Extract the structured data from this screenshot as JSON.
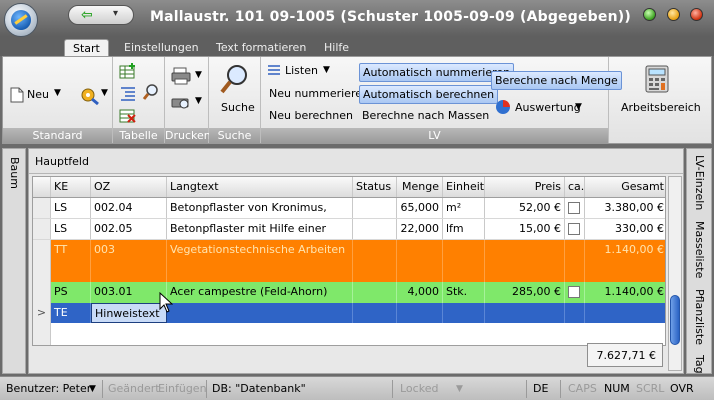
{
  "window": {
    "title": "Mallaustr. 101 09-1005 (Schuster 1005-09-09 (Abgegeben))",
    "qat_back": "⇦",
    "qat_menu": "▾"
  },
  "tabs": [
    "Start",
    "Einstellungen",
    "Text formatieren",
    "Hilfe"
  ],
  "ribbon": {
    "standard": {
      "neu": "Neu",
      "label": "Standard"
    },
    "tabelle": {
      "label": "Tabelle"
    },
    "drucken": {
      "label": "Drucken"
    },
    "suche": {
      "button": "Suche",
      "label": "Suche"
    },
    "lv": {
      "listen": "Listen",
      "neu_nummerieren": "Neu nummerieren",
      "neu_berechnen": "Neu berechnen",
      "auto_nummerieren": "Automatisch nummerieren",
      "auto_berechnen": "Automatisch berechnen",
      "berechne_massen": "Berechne nach Massen",
      "berechne_menge": "Berechne nach Menge",
      "auswertung": "Auswertung",
      "label": "LV"
    },
    "arbeitsbereich": "Arbeitsbereich"
  },
  "left_tab": "Baum",
  "right_tabs": [
    "LV-Einzeln",
    "Masseliste",
    "Pflanzliste",
    "Tag"
  ],
  "panel_title": "Hauptfeld",
  "grid": {
    "columns": [
      "KE",
      "OZ",
      "Langtext",
      "Status",
      "Menge",
      "Einheit",
      "Preis",
      "ca.",
      "Gesamt"
    ],
    "rows": [
      {
        "ke": "LS",
        "oz": "002.04",
        "text": "Betonpflaster von Kronimus,",
        "status": "",
        "menge": "65,000",
        "einheit": "m²",
        "preis": "52,00 €",
        "ca": true,
        "gesamt": "3.380,00 €"
      },
      {
        "ke": "LS",
        "oz": "002.05",
        "text": "Betonpflaster mit Hilfe einer",
        "status": "",
        "menge": "22,000",
        "einheit": "lfm",
        "preis": "15,00 €",
        "ca": true,
        "gesamt": "330,00 €"
      },
      {
        "ke": "TT",
        "oz": "003",
        "text": "Vegetationstechnische Arbeiten",
        "status": "",
        "menge": "",
        "einheit": "",
        "preis": "",
        "ca": false,
        "gesamt": "1.140,00 €"
      },
      {
        "ke": "PS",
        "oz": "003.01",
        "text": "Acer campestre (Feld-Ahorn)",
        "status": "",
        "menge": "4,000",
        "einheit": "Stk.",
        "preis": "285,00 €",
        "ca": true,
        "gesamt": "1.140,00 €"
      },
      {
        "ke": "TE",
        "oz": "Hinweistext",
        "text": "",
        "status": "",
        "menge": "",
        "einheit": "",
        "preis": "",
        "ca": false,
        "gesamt": ""
      }
    ],
    "row_indicator": ">",
    "total": "7.627,71 €",
    "colors": {
      "title_row": "#ff8000",
      "position_row": "#7fe86a",
      "selected_row": "#2f64c6"
    }
  },
  "status": {
    "benutzer": "Benutzer: Peter",
    "geaendert": "Geändert",
    "einfuegen": "Einfügen",
    "db": "DB: \"Datenbank\"",
    "locked": "Locked",
    "lang": "DE",
    "caps": "CAPS",
    "num": "NUM",
    "scrl": "SCRL",
    "ovr": "OVR"
  }
}
